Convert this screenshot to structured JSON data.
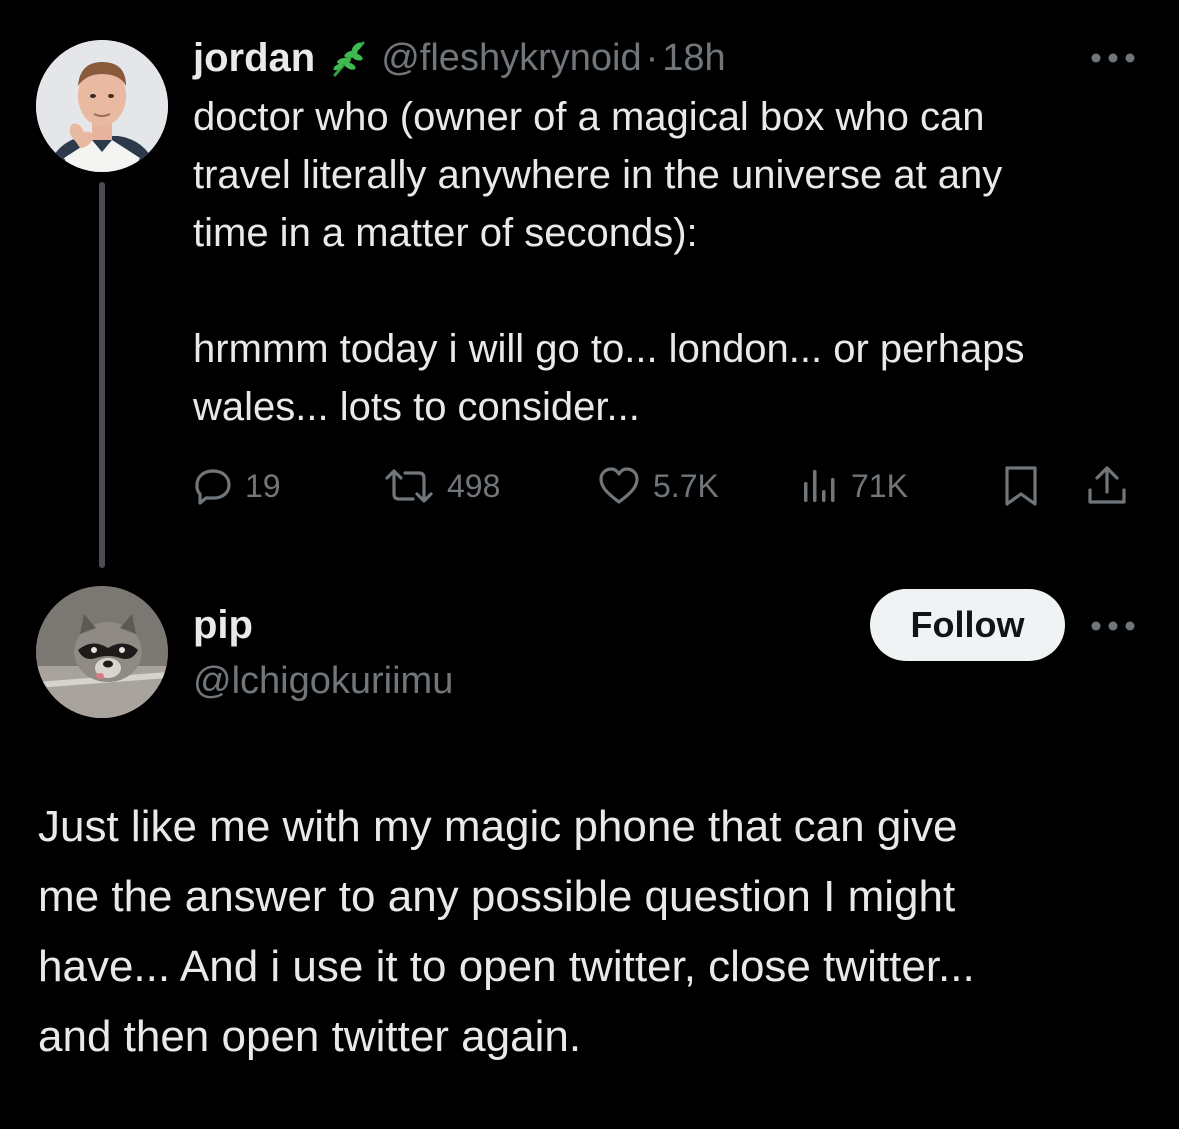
{
  "tweet": {
    "author_name": "jordan",
    "author_handle": "@fleshykrynoid",
    "separator": "·",
    "time": "18h",
    "badge_icon": "leaf-icon",
    "text_lines": [
      "doctor who (owner of a magical box who can",
      "travel literally anywhere in the universe at any",
      "time in a matter of seconds):"
    ],
    "text_lines_2": [
      "hrmmm today i will go to... london... or perhaps",
      "wales... lots to consider..."
    ],
    "actions": {
      "replies": "19",
      "reposts": "498",
      "likes": "5.7K",
      "views": "71K"
    }
  },
  "reply": {
    "author_name": "pip",
    "author_handle": "@lchigokuriimu",
    "follow_label": "Follow",
    "text_lines": [
      "Just like me with my magic phone that can give",
      "me the answer to any possible question I might",
      "have... And i use it to open twitter, close twitter...",
      "and then open twitter again."
    ]
  },
  "colors": {
    "background": "#000000",
    "text_primary": "#e7e9ea",
    "text_secondary": "#71767b",
    "thread_line": "#4a4e52",
    "follow_bg": "#eff3f4",
    "badge_green": "#2f9e44"
  }
}
